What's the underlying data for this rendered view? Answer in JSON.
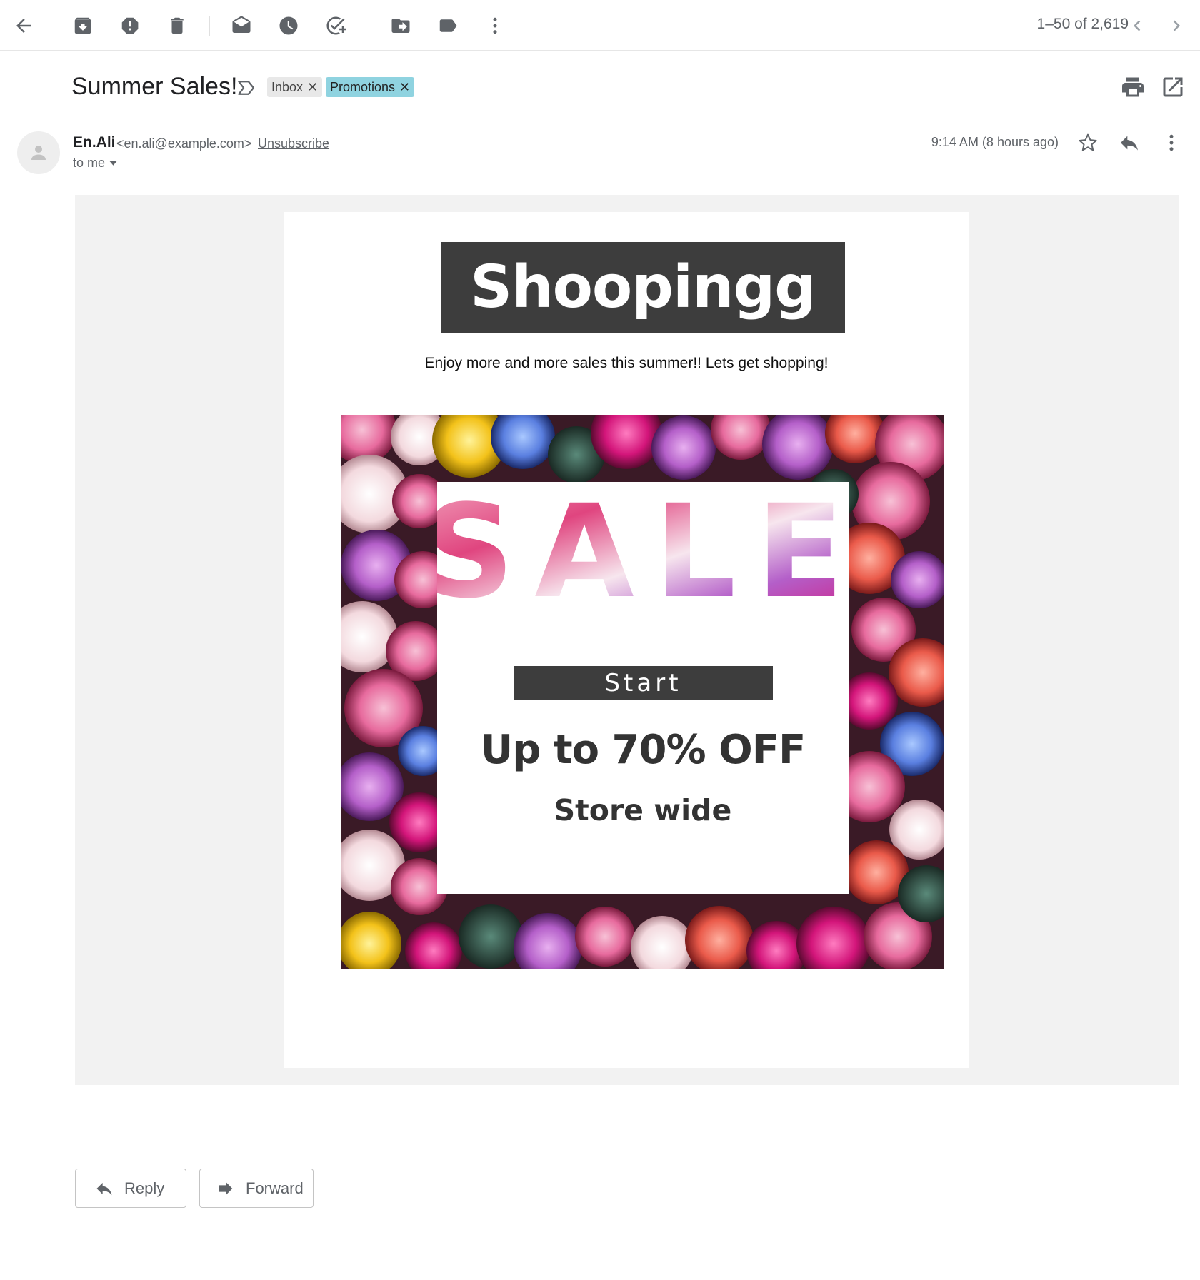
{
  "toolbar": {
    "icons": [
      "back-arrow-icon",
      "archive-icon",
      "report-spam-icon",
      "delete-icon",
      "mark-unread-icon",
      "snooze-icon",
      "add-task-icon",
      "move-to-icon",
      "labels-icon",
      "more-vertical-icon"
    ],
    "page_count": "1–50 of 2,619",
    "prev_icon": "chevron-left-icon",
    "next_icon": "chevron-right-icon"
  },
  "subject": {
    "title": "Summer Sales!",
    "labels": [
      {
        "name": "Inbox",
        "color": "#e8e8e8"
      },
      {
        "name": "Promotions",
        "color": "#8fd3e0"
      }
    ],
    "remove_glyph": "✕"
  },
  "sender": {
    "name": "En.Ali",
    "email": "<en.ali@example.com>",
    "unsubscribe": "Unsubscribe",
    "to": "to me",
    "time": "9:14 AM (8 hours ago)"
  },
  "email": {
    "logo": "Shoopingg",
    "tagline": "Enjoy more and more sales this summer!! Lets get shopping!",
    "banner": {
      "headline": "SALE",
      "start": "Start",
      "offer": "Up to 70% OFF",
      "subline": "Store wide"
    }
  },
  "actions": {
    "reply": "Reply",
    "forward": "Forward"
  },
  "colors": {
    "dark_box": "#3d3d3d",
    "label_promotions": "#8fd3e0",
    "body_bg": "#f2f2f2"
  }
}
